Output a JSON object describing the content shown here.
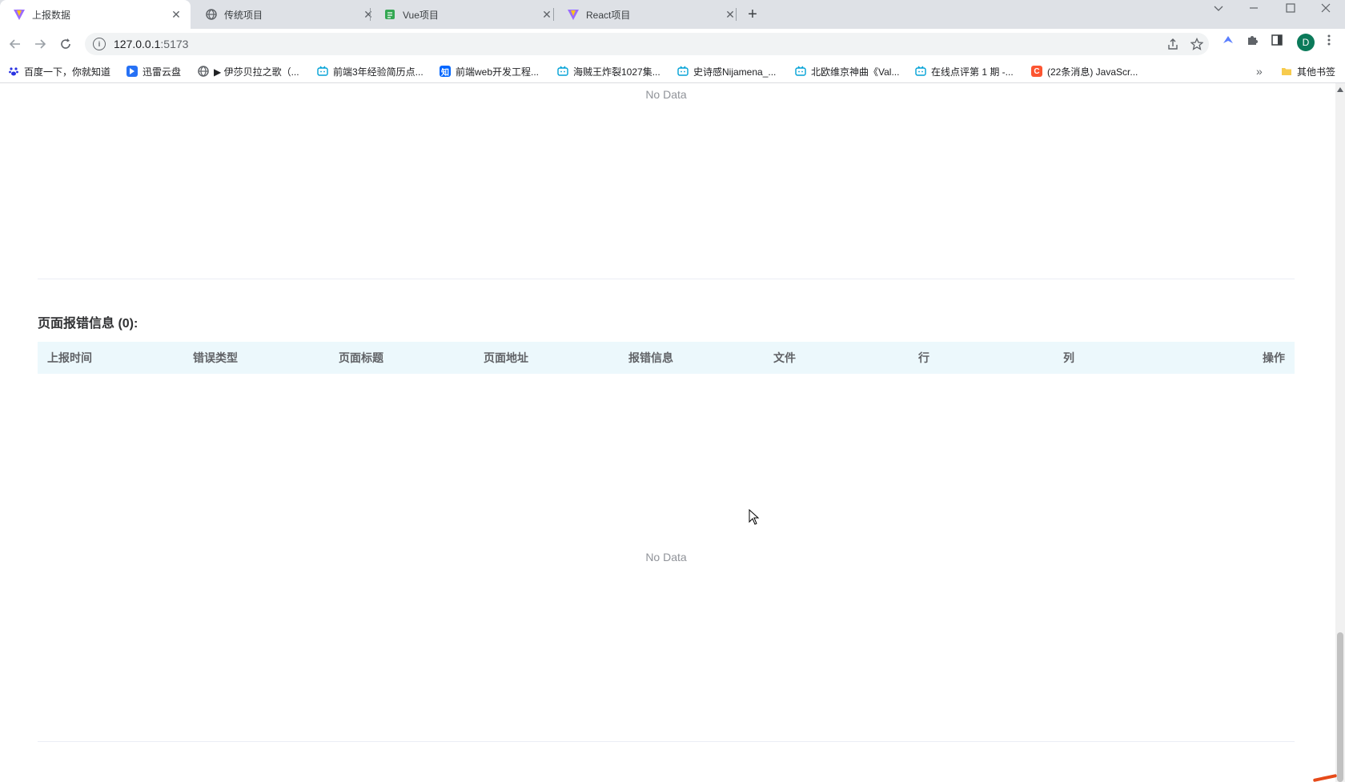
{
  "browser": {
    "tabs": [
      {
        "title": "上报数据",
        "icon": "vite-logo-icon",
        "active": true
      },
      {
        "title": "传统项目",
        "icon": "globe-icon",
        "active": false
      },
      {
        "title": "Vue项目",
        "icon": "sheet-icon",
        "active": false
      },
      {
        "title": "React项目",
        "icon": "vite-logo-icon",
        "active": false
      }
    ],
    "close_glyph": "✕",
    "new_tab_glyph": "+",
    "url_host": "127.0.0.1",
    "url_port": ":5173",
    "avatar_letter": "D",
    "bookmarks": [
      {
        "label": "百度一下，你就知道",
        "icon": "paw-icon"
      },
      {
        "label": "迅雷云盘",
        "icon": "thunder-icon"
      },
      {
        "label": "▶ 伊莎贝拉之歌（...",
        "icon": "globe-icon"
      },
      {
        "label": "前端3年经验简历点...",
        "icon": "bilibili-icon"
      },
      {
        "label": "前端web开发工程...",
        "icon": "zhihu-icon"
      },
      {
        "label": "海贼王炸裂1027集...",
        "icon": "bilibili-icon"
      },
      {
        "label": "史诗感Nijamena_...",
        "icon": "bilibili-icon"
      },
      {
        "label": "北欧维京神曲《Val...",
        "icon": "bilibili-icon"
      },
      {
        "label": "在线点评第 1 期 -...",
        "icon": "bilibili-icon"
      },
      {
        "label": "(22条消息) JavaScr...",
        "icon": "csdn-icon"
      }
    ],
    "bookmarks_overflow": "»",
    "other_bookmarks": "其他书签"
  },
  "page": {
    "top_empty_text": "No Data",
    "section_title": "页面报错信息 (0):",
    "table_headers": [
      "上报时间",
      "错误类型",
      "页面标题",
      "页面地址",
      "报错信息",
      "文件",
      "行",
      "列",
      "操作"
    ],
    "table_empty_text": "No Data"
  },
  "colors": {
    "table_header_bg": "#ecf8fc",
    "avatar_bg": "#0b7a5a",
    "empty_text": "#909399"
  }
}
